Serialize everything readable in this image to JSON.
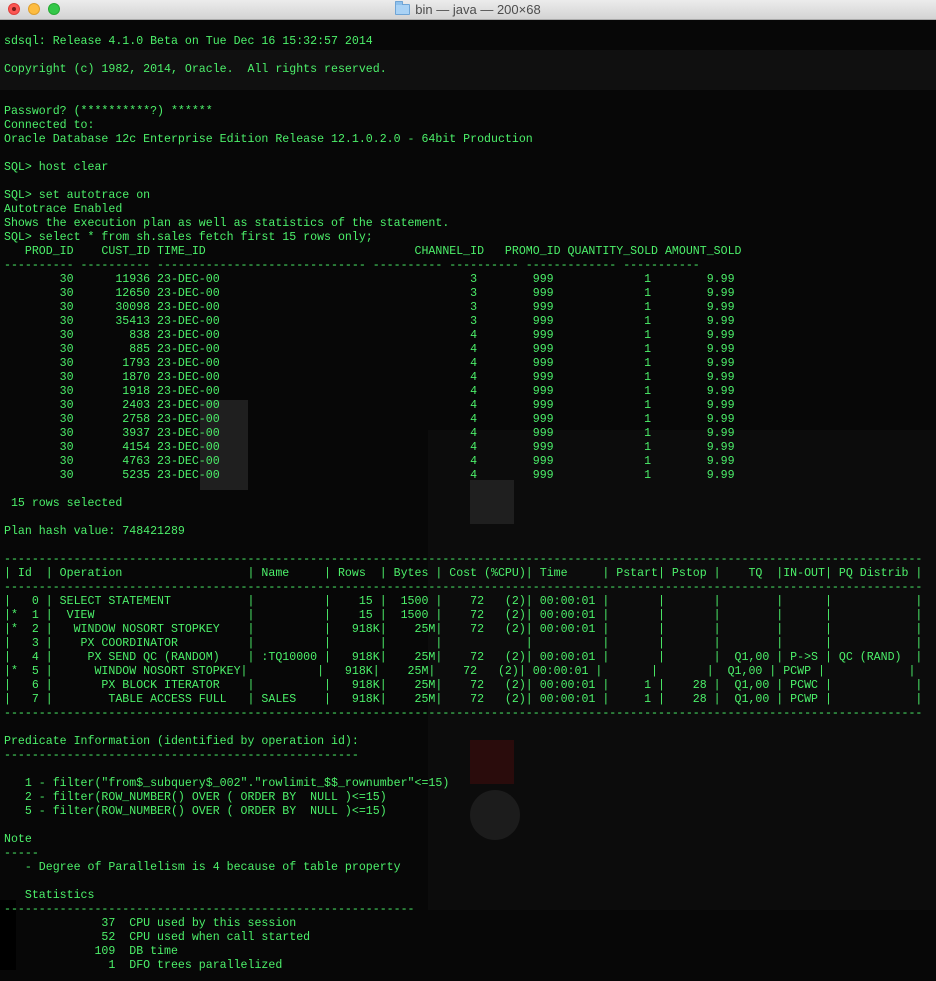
{
  "window": {
    "title": "bin — java — 200×68",
    "folder_icon": "folder-icon",
    "controls": [
      "close",
      "minimize",
      "zoom"
    ]
  },
  "colors": {
    "terminal_text": "#4cf06a",
    "terminal_background": "#070707"
  },
  "terminal": {
    "lines": [
      "sdsql: Release 4.1.0 Beta on Tue Dec 16 15:32:57 2014",
      "",
      "Copyright (c) 1982, 2014, Oracle.  All rights reserved.",
      "",
      "",
      "Password? (**********?) ******",
      "Connected to:",
      "Oracle Database 12c Enterprise Edition Release 12.1.0.2.0 - 64bit Production",
      "",
      "SQL> host clear",
      "",
      "SQL> set autotrace on",
      "Autotrace Enabled",
      "Shows the execution plan as well as statistics of the statement.",
      "SQL> select * from sh.sales fetch first 15 rows only;",
      "   PROD_ID    CUST_ID TIME_ID                              CHANNEL_ID   PROMO_ID QUANTITY_SOLD AMOUNT_SOLD",
      "---------- ---------- ------------------------------ ---------- ---------- ------------- -----------",
      "        30      11936 23-DEC-00                                    3        999             1        9.99",
      "        30      12650 23-DEC-00                                    3        999             1        9.99",
      "        30      30098 23-DEC-00                                    3        999             1        9.99",
      "        30      35413 23-DEC-00                                    3        999             1        9.99",
      "        30        838 23-DEC-00                                    4        999             1        9.99",
      "        30        885 23-DEC-00                                    4        999             1        9.99",
      "        30       1793 23-DEC-00                                    4        999             1        9.99",
      "        30       1870 23-DEC-00                                    4        999             1        9.99",
      "        30       1918 23-DEC-00                                    4        999             1        9.99",
      "        30       2403 23-DEC-00                                    4        999             1        9.99",
      "        30       2758 23-DEC-00                                    4        999             1        9.99",
      "        30       3937 23-DEC-00                                    4        999             1        9.99",
      "        30       4154 23-DEC-00                                    4        999             1        9.99",
      "        30       4763 23-DEC-00                                    4        999             1        9.99",
      "        30       5235 23-DEC-00                                    4        999             1        9.99",
      "",
      " 15 rows selected",
      "",
      "Plan hash value: 748421289",
      "",
      "------------------------------------------------------------------------------------------------------------------------------------",
      "| Id  | Operation                  | Name     | Rows  | Bytes | Cost (%CPU)| Time     | Pstart| Pstop |    TQ  |IN-OUT| PQ Distrib |",
      "------------------------------------------------------------------------------------------------------------------------------------",
      "|   0 | SELECT STATEMENT           |          |    15 |  1500 |    72   (2)| 00:00:01 |       |       |        |      |            |",
      "|*  1 |  VIEW                      |          |    15 |  1500 |    72   (2)| 00:00:01 |       |       |        |      |            |",
      "|*  2 |   WINDOW NOSORT STOPKEY    |          |   918K|    25M|    72   (2)| 00:00:01 |       |       |        |      |            |",
      "|   3 |    PX COORDINATOR          |          |       |       |            |          |       |       |        |      |            |",
      "|   4 |     PX SEND QC (RANDOM)    | :TQ10000 |   918K|    25M|    72   (2)| 00:00:01 |       |       |  Q1,00 | P->S | QC (RAND)  |",
      "|*  5 |      WINDOW NOSORT STOPKEY|          |   918K|    25M|    72   (2)| 00:00:01 |       |       |  Q1,00 | PCWP |            |",
      "|   6 |       PX BLOCK ITERATOR    |          |   918K|    25M|    72   (2)| 00:00:01 |     1 |    28 |  Q1,00 | PCWC |            |",
      "|   7 |        TABLE ACCESS FULL   | SALES    |   918K|    25M|    72   (2)| 00:00:01 |     1 |    28 |  Q1,00 | PCWP |            |",
      "------------------------------------------------------------------------------------------------------------------------------------",
      "",
      "Predicate Information (identified by operation id):",
      "---------------------------------------------------",
      "",
      "   1 - filter(\"from$_subquery$_002\".\"rowlimit_$$_rownumber\"<=15)",
      "   2 - filter(ROW_NUMBER() OVER ( ORDER BY  NULL )<=15)",
      "   5 - filter(ROW_NUMBER() OVER ( ORDER BY  NULL )<=15)",
      "",
      "Note",
      "-----",
      "   - Degree of Parallelism is 4 because of table property",
      "",
      "   Statistics",
      "-----------------------------------------------------------",
      "              37  CPU used by this session",
      "              52  CPU used when call started",
      "             109  DB time",
      "               1  DFO trees parallelized"
    ]
  }
}
